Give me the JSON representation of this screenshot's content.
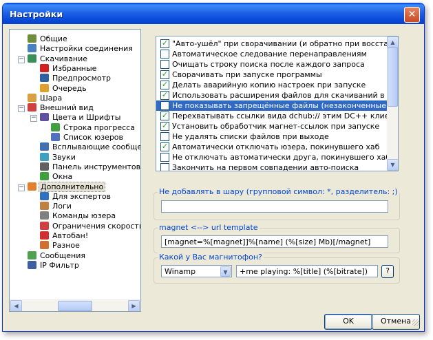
{
  "window": {
    "title": "Настройки",
    "close_label": "✕"
  },
  "tree": {
    "items": [
      {
        "label": "Общие",
        "icon": "users-icon",
        "color": "#6b8e3a",
        "level": 1
      },
      {
        "label": "Настройки соединения",
        "icon": "network-icon",
        "color": "#4a7fc0",
        "level": 1
      },
      {
        "label": "Скачивание",
        "icon": "download-icon",
        "color": "#3a8e5a",
        "level": 1,
        "expander": "−"
      },
      {
        "label": "Избранные",
        "icon": "heart-icon",
        "color": "#d02020",
        "level": 2
      },
      {
        "label": "Предпросмотр",
        "icon": "preview-icon",
        "color": "#3060a0",
        "level": 2
      },
      {
        "label": "Очередь",
        "icon": "queue-icon",
        "color": "#e0a030",
        "level": 2
      },
      {
        "label": "Шара",
        "icon": "share-icon",
        "color": "#d8a040",
        "level": 1
      },
      {
        "label": "Внешний вид",
        "icon": "appearance-icon",
        "color": "#d04040",
        "level": 1,
        "expander": "−"
      },
      {
        "label": "Цвета и Шрифты",
        "icon": "palette-icon",
        "color": "#6050a0",
        "level": 2,
        "expander": "−"
      },
      {
        "label": "Строка прогресса",
        "icon": "progress-icon",
        "color": "#40a040",
        "level": 3
      },
      {
        "label": "Список юзеров",
        "icon": "userlist-icon",
        "color": "#5070c0",
        "level": 3
      },
      {
        "label": "Всплывающие сообщения",
        "icon": "popup-icon",
        "color": "#4070b0",
        "level": 2
      },
      {
        "label": "Звуки",
        "icon": "sound-icon",
        "color": "#40a0c0",
        "level": 2
      },
      {
        "label": "Панель инструментов",
        "icon": "toolbar-icon",
        "color": "#606060",
        "level": 2
      },
      {
        "label": "Окна",
        "icon": "windows-icon",
        "color": "#40a040",
        "level": 2
      },
      {
        "label": "Дополнительно",
        "icon": "advanced-icon",
        "color": "#e08030",
        "level": 1,
        "expander": "−",
        "selected": true
      },
      {
        "label": "Для экспертов",
        "icon": "expert-icon",
        "color": "#3070c0",
        "level": 2
      },
      {
        "label": "Логи",
        "icon": "logs-icon",
        "color": "#c08040",
        "level": 2
      },
      {
        "label": "Команды юзера",
        "icon": "commands-icon",
        "color": "#808080",
        "level": 2
      },
      {
        "label": "Ограничения скорости",
        "icon": "speed-limit-icon",
        "color": "#d04040",
        "level": 2
      },
      {
        "label": "Автобан!",
        "icon": "autoban-icon",
        "color": "#d03030",
        "level": 2
      },
      {
        "label": "Разное",
        "icon": "misc-icon",
        "color": "#d07030",
        "level": 2
      },
      {
        "label": "Сообщения",
        "icon": "messages-icon",
        "color": "#50a050",
        "level": 1
      },
      {
        "label": "IP Фильтр",
        "icon": "ip-filter-icon",
        "color": "#4060a0",
        "level": 1
      }
    ]
  },
  "options": {
    "items": [
      {
        "label": "\"Авто-ушёл\" при сворачивании (и обратно при восстановлении)",
        "checked": true
      },
      {
        "label": "Автоматическое следование перенаправлениям",
        "checked": false
      },
      {
        "label": "Очищать строку поиска после каждого запроса",
        "checked": false
      },
      {
        "label": "Сворачивать при запуске программы",
        "checked": true
      },
      {
        "label": "Делать аварийную копию настроек при запуске",
        "checked": true
      },
      {
        "label": "Использовать расширения файлов для скачиваний в поиске",
        "checked": true
      },
      {
        "label": "Не показывать запрещённые файлы (незаконченные Kazaa, WinMX,",
        "checked": false,
        "selected": true
      },
      {
        "label": "Перехватывать ссылки вида dchub:// этим DC++ клиентом",
        "checked": true
      },
      {
        "label": "Установить обработчик магнет-ссылок при запуске",
        "checked": true
      },
      {
        "label": "Не удалять списки файлов при выходе",
        "checked": false
      },
      {
        "label": "Автоматически отключать юзера, покинувшего хаб",
        "checked": true
      },
      {
        "label": "Не отключать автоматически друга, покинувшего хаб",
        "checked": false
      },
      {
        "label": "Закончить на первом совпадении авто-поиска",
        "checked": false
      }
    ]
  },
  "share_group": {
    "title": "Не добавлять в шару (групповой символ: *, разделитель: ;)",
    "value": ""
  },
  "magnet_group": {
    "title": "magnet <--> url template",
    "value": "[magnet=%[magnet]]%[name] (%[size] Mb)[/magnet]"
  },
  "player_group": {
    "title": "Какой у Вас магнитофон?",
    "selected_player": "Winamp",
    "format": "+me playing: %[title] (%[bitrate])",
    "help_label": "?"
  },
  "buttons": {
    "ok": "OK",
    "cancel": "Отмена"
  }
}
